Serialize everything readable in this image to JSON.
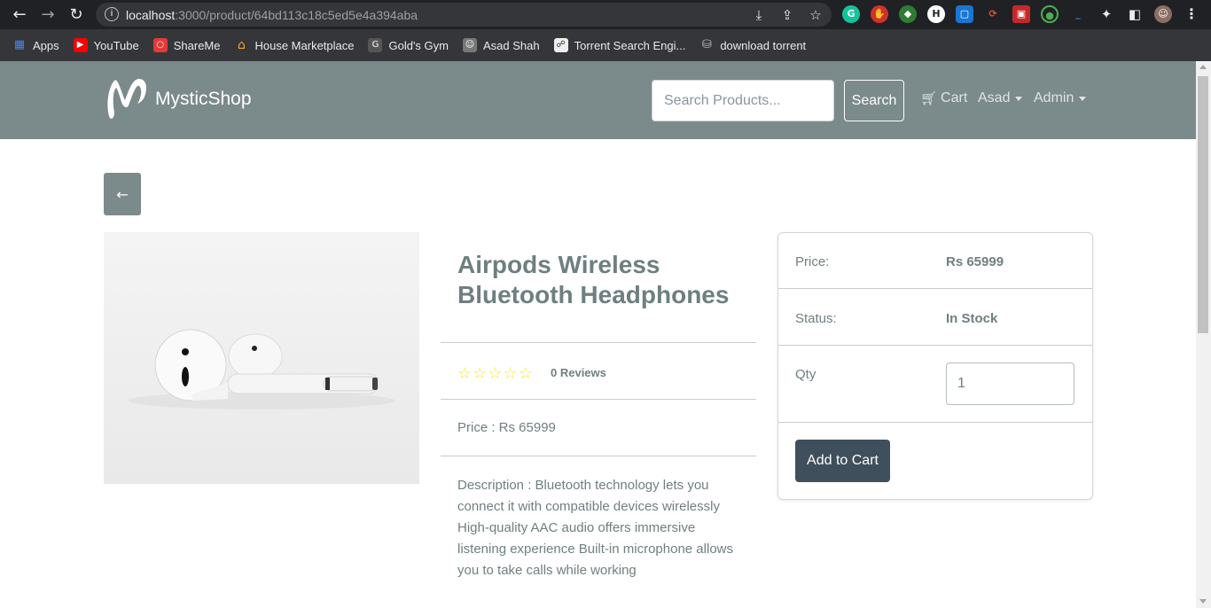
{
  "browser": {
    "url_host": "localhost",
    "url_rest": ":3000/product/64bd113c18c5ed5e4a394aba",
    "bookmarks": [
      {
        "label": "Apps",
        "icon": "apps-grid-icon",
        "color": "#4285f4"
      },
      {
        "label": "YouTube",
        "icon": "youtube-icon",
        "color": "#ff0000"
      },
      {
        "label": "ShareMe",
        "icon": "shareme-icon",
        "color": "#e53935"
      },
      {
        "label": "House Marketplace",
        "icon": "house-icon",
        "color": "#f9a825"
      },
      {
        "label": "Gold's Gym",
        "icon": "gym-icon",
        "color": "#555555"
      },
      {
        "label": "Asad Shah",
        "icon": "profile-icon",
        "color": "#777777"
      },
      {
        "label": "Torrent Search Engi...",
        "icon": "torrent-icon",
        "color": "#dddddd"
      },
      {
        "label": "download torrent",
        "icon": "database-icon",
        "color": "#bdbdbd"
      }
    ]
  },
  "nav": {
    "brand": "MysticShop",
    "search_placeholder": "Search Products...",
    "search_label": "Search",
    "cart_label": "Cart",
    "user_label": "Asad",
    "admin_label": "Admin"
  },
  "product": {
    "back_label": "←",
    "name": "Airpods Wireless Bluetooth Headphones",
    "rating": 0,
    "reviews_text": "0 Reviews",
    "price_text": "Price : Rs 65999",
    "description": "Description : Bluetooth technology lets you connect it with compatible devices wirelessly High-quality AAC audio offers immersive listening experience Built-in microphone allows you to take calls while working"
  },
  "purchase": {
    "price_label": "Price:",
    "price_value": "Rs 65999",
    "status_label": "Status:",
    "status_value": "In Stock",
    "qty_label": "Qty",
    "qty_value": "1",
    "add_label": "Add to Cart"
  },
  "colors": {
    "navbar": "#7b8a8b",
    "primary_button": "#3f4f5b",
    "star": "#f8e825"
  }
}
